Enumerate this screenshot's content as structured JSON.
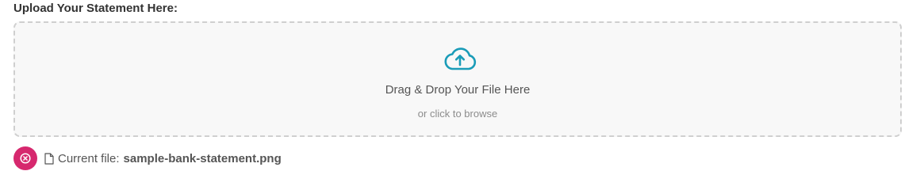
{
  "upload": {
    "label": "Upload Your Statement Here:",
    "dropzone": {
      "title": "Drag & Drop Your File Here",
      "subtitle": "or click to browse",
      "icon": "cloud-upload-icon"
    }
  },
  "current_file": {
    "prefix": "Current file:",
    "name": "sample-bank-statement.png",
    "remove_icon": "remove-circle-icon",
    "file_icon": "document-icon"
  },
  "colors": {
    "accent": "#1a9cb8",
    "remove": "#d6286e",
    "dropzone_bg": "#f8f8f8",
    "dropzone_border": "#cfcfcf"
  }
}
